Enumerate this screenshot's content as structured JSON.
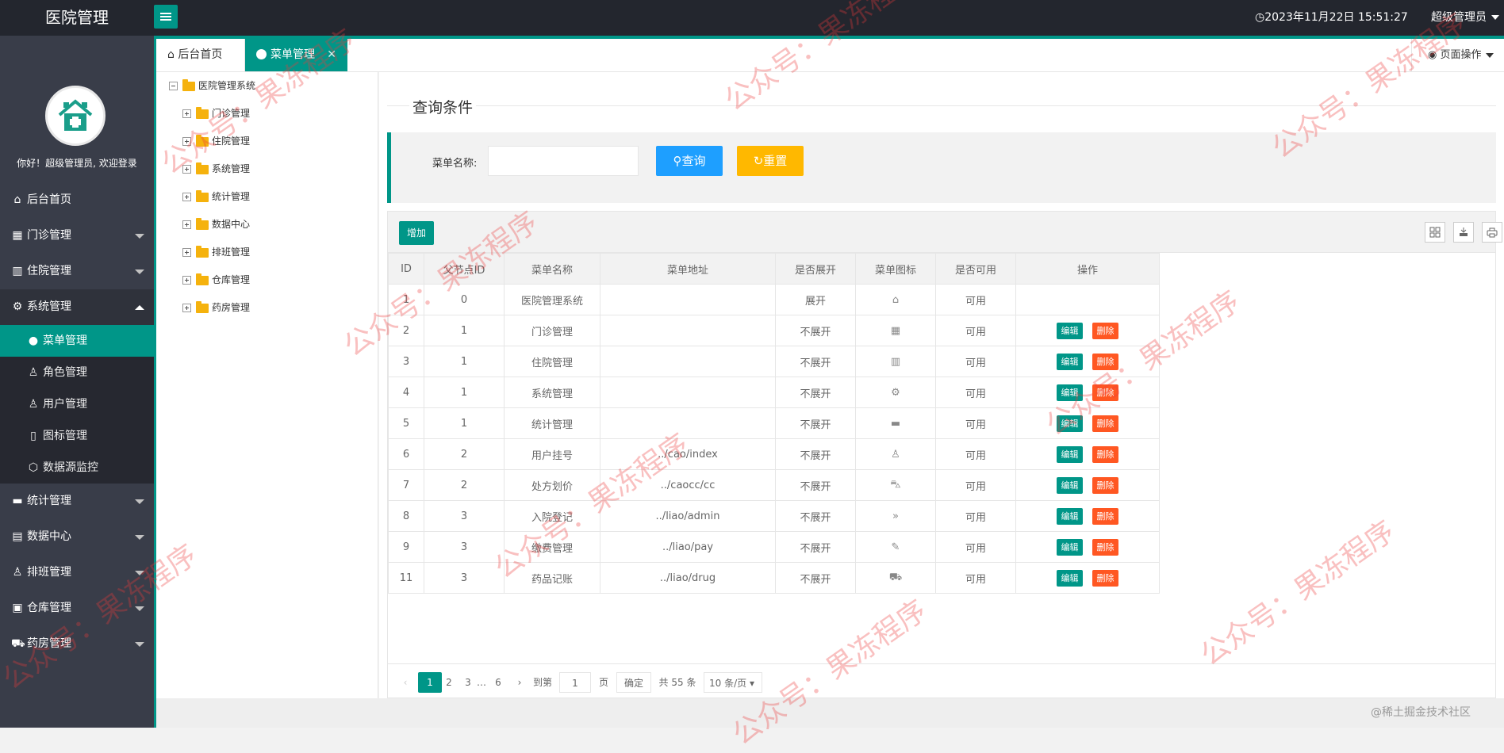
{
  "app": {
    "title": "医院管理",
    "datetime": "2023年11月22日 15:51:27",
    "user_menu": "超级管理员",
    "welcome": "你好！超级管理员, 欢迎登录"
  },
  "sidebar": {
    "items": [
      {
        "label": "后台首页",
        "icon": "home-icon"
      },
      {
        "label": "门诊管理",
        "icon": "grid-icon"
      },
      {
        "label": "住院管理",
        "icon": "building-icon"
      },
      {
        "label": "系统管理",
        "icon": "gear-icon",
        "expanded": true
      },
      {
        "label": "统计管理",
        "icon": "monitor-icon"
      },
      {
        "label": "数据中心",
        "icon": "document-icon"
      },
      {
        "label": "排班管理",
        "icon": "users-icon"
      },
      {
        "label": "仓库管理",
        "icon": "boxes-icon"
      },
      {
        "label": "药房管理",
        "icon": "pharmacy-icon"
      }
    ],
    "sub_items": [
      {
        "label": "菜单管理",
        "icon": "circle-icon",
        "active": true
      },
      {
        "label": "角色管理",
        "icon": "person-icon"
      },
      {
        "label": "用户管理",
        "icon": "user-icon"
      },
      {
        "label": "图标管理",
        "icon": "note-icon"
      },
      {
        "label": "数据源监控",
        "icon": "cube-icon"
      }
    ]
  },
  "tabs": {
    "home": "后台首页",
    "current": "菜单管理",
    "close": "✕",
    "page_ops": "页面操作"
  },
  "tree": {
    "root": "医院管理系统",
    "children": [
      "门诊管理",
      "住院管理",
      "系统管理",
      "统计管理",
      "数据中心",
      "排班管理",
      "仓库管理",
      "药房管理"
    ]
  },
  "query": {
    "legend": "查询条件",
    "label": "菜单名称:",
    "value": "",
    "search_label": "查询",
    "reset_label": "重置"
  },
  "table": {
    "add_label": "增加",
    "columns": [
      "ID",
      "父节点ID",
      "菜单名称",
      "菜单地址",
      "是否展开",
      "菜单图标",
      "是否可用",
      "操作"
    ],
    "rows": [
      {
        "id": "1",
        "pid": "0",
        "name": "医院管理系统",
        "url": "",
        "expand": "展开",
        "icon": "home-icon",
        "enabled": "可用",
        "ops": false
      },
      {
        "id": "2",
        "pid": "1",
        "name": "门诊管理",
        "url": "",
        "expand": "不展开",
        "icon": "grid-icon",
        "enabled": "可用",
        "ops": true
      },
      {
        "id": "3",
        "pid": "1",
        "name": "住院管理",
        "url": "",
        "expand": "不展开",
        "icon": "building-icon",
        "enabled": "可用",
        "ops": true
      },
      {
        "id": "4",
        "pid": "1",
        "name": "系统管理",
        "url": "",
        "expand": "不展开",
        "icon": "gear-icon",
        "enabled": "可用",
        "ops": true
      },
      {
        "id": "5",
        "pid": "1",
        "name": "统计管理",
        "url": "",
        "expand": "不展开",
        "icon": "monitor-icon",
        "enabled": "可用",
        "ops": true
      },
      {
        "id": "6",
        "pid": "2",
        "name": "用户挂号",
        "url": "../cao/index",
        "expand": "不展开",
        "icon": "user-icon",
        "enabled": "可用",
        "ops": true
      },
      {
        "id": "7",
        "pid": "2",
        "name": "处方划价",
        "url": "../caocc/cc",
        "expand": "不展开",
        "icon": "cart-icon",
        "enabled": "可用",
        "ops": true
      },
      {
        "id": "8",
        "pid": "3",
        "name": "入院登记",
        "url": "../liao/admin",
        "expand": "不展开",
        "icon": "double-chevron-icon",
        "enabled": "可用",
        "ops": true
      },
      {
        "id": "9",
        "pid": "3",
        "name": "缴费管理",
        "url": "../liao/pay",
        "expand": "不展开",
        "icon": "edit-icon",
        "enabled": "可用",
        "ops": true
      },
      {
        "id": "11",
        "pid": "3",
        "name": "药品记账",
        "url": "../liao/drug",
        "expand": "不展开",
        "icon": "pharmacy-icon",
        "enabled": "可用",
        "ops": true
      }
    ],
    "edit_label": "编辑",
    "delete_label": "删除"
  },
  "pager": {
    "pages": [
      "1",
      "2",
      "3",
      "…",
      "6"
    ],
    "goto_label": "到第",
    "goto_value": "1",
    "page_unit": "页",
    "confirm_label": "确定",
    "total": "共 55 条",
    "per_page": "10 条/页"
  },
  "watermark": "公众号：果冻程序",
  "credit": "@稀土掘金技术社区",
  "colors": {
    "primary": "#009688",
    "sidebar": "#393d49",
    "topbar": "#23262e",
    "search": "#1e9fff",
    "reset": "#ffb800",
    "danger": "#ff5722"
  }
}
